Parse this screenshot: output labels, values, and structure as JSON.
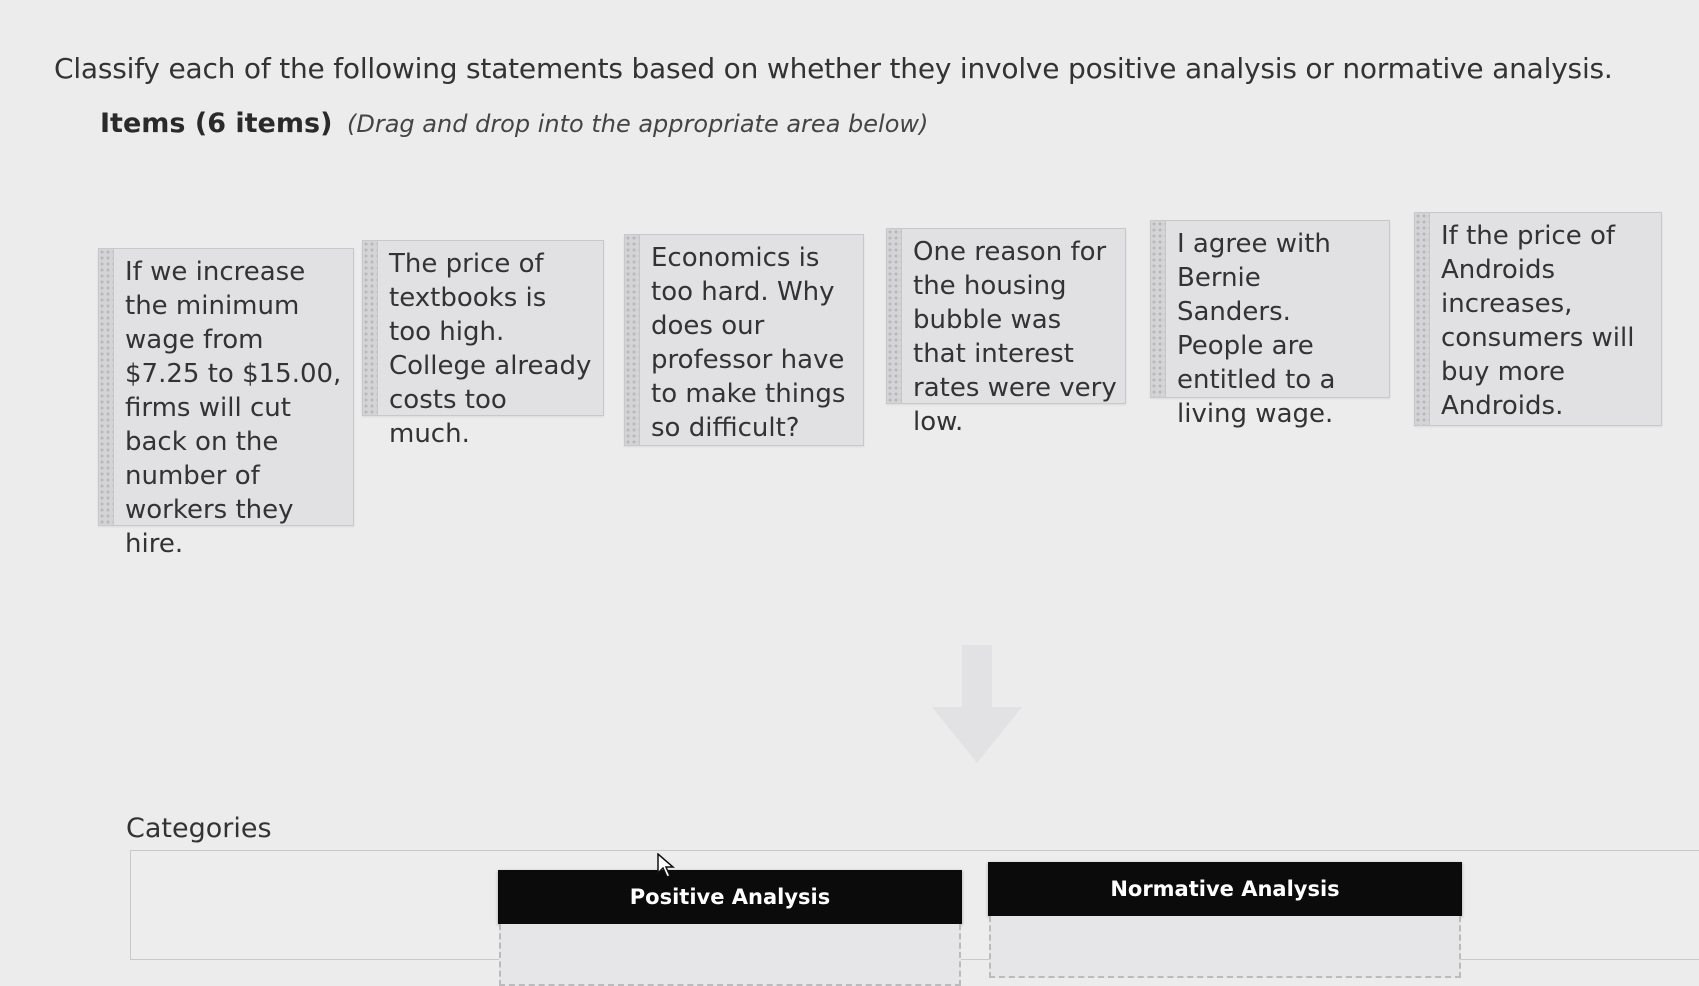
{
  "question": "Classify each of the following statements based on whether they involve positive analysis or normative analysis.",
  "items_heading": {
    "label": "Items (6 items)",
    "hint": "(Drag and drop into the appropriate area below)"
  },
  "items": [
    {
      "text": "If we increase the minimum wage from $7.25 to $15.00, firms will cut back on the number of workers they hire."
    },
    {
      "text": "The price of textbooks is too high. College already costs too much."
    },
    {
      "text": "Economics is too hard. Why does our professor have to make things so difficult?"
    },
    {
      "text": "One reason for the housing bubble was that interest rates were very low."
    },
    {
      "text": "I agree with Bernie Sanders. People are entitled to a living wage."
    },
    {
      "text": "If the price of Androids increases, consumers will buy more Androids."
    }
  ],
  "categories_label": "Categories",
  "categories": [
    {
      "label": "Positive Analysis"
    },
    {
      "label": "Normative Analysis"
    }
  ],
  "icons": {
    "drop_arrow": "arrow-down-icon",
    "cursor": "mouse-pointer-icon"
  },
  "colors": {
    "background": "#ececed",
    "tile": "#e1e1e3",
    "category_header": "#0b0b0b",
    "category_header_text": "#ffffff"
  }
}
